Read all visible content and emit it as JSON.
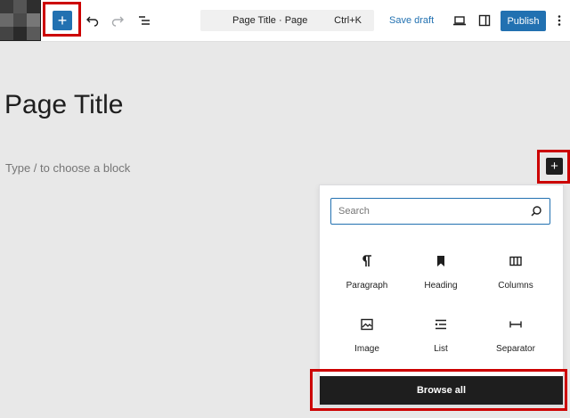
{
  "toolbar": {
    "add_block_label": "+",
    "document_title": "Page Title · Page",
    "command_shortcut": "Ctrl+K",
    "save_draft_label": "Save draft",
    "publish_label": "Publish"
  },
  "editor": {
    "page_title": "Page Title",
    "block_placeholder": "Type / to choose a block",
    "inline_inserter_label": "+"
  },
  "inserter": {
    "search_placeholder": "Search",
    "blocks": [
      {
        "label": "Paragraph",
        "icon": "paragraph-icon"
      },
      {
        "label": "Heading",
        "icon": "heading-icon"
      },
      {
        "label": "Columns",
        "icon": "columns-icon"
      },
      {
        "label": "Image",
        "icon": "image-icon"
      },
      {
        "label": "List",
        "icon": "list-icon"
      },
      {
        "label": "Separator",
        "icon": "separator-icon"
      }
    ],
    "browse_all_label": "Browse all"
  },
  "colors": {
    "accent": "#2271b1",
    "highlight": "#cc0000",
    "dark": "#1e1e1e",
    "canvas": "#e8e8e8"
  }
}
